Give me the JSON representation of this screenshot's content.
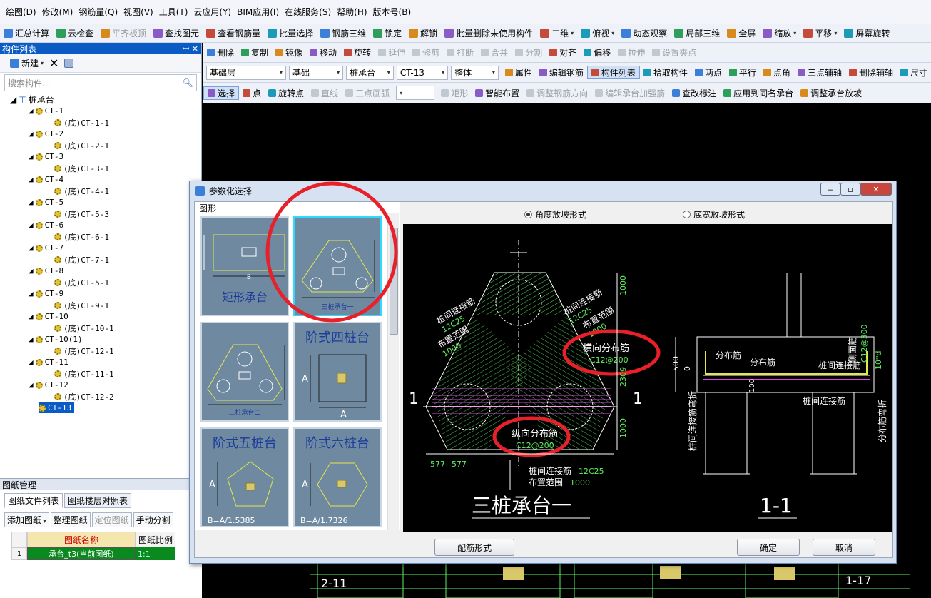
{
  "menubar": [
    "绘图(D)",
    "修改(M)",
    "钢筋量(Q)",
    "视图(V)",
    "工具(T)",
    "云应用(Y)",
    "BIM应用(I)",
    "在线服务(S)",
    "帮助(H)",
    "版本号(B)"
  ],
  "toolbar1": [
    {
      "label": "汇总计算",
      "icon": "sigma-icon"
    },
    {
      "label": "云检查",
      "icon": "check-icon"
    },
    {
      "label": "平齐板顶",
      "icon": "align-icon",
      "disabled": true
    },
    {
      "label": "查找图元",
      "icon": "binoculars-icon"
    },
    {
      "label": "查看钢筋量",
      "icon": "rebar-icon"
    },
    {
      "label": "批量选择",
      "icon": "batch-icon"
    },
    {
      "label": "钢筋三维",
      "icon": "rebar3d-icon"
    },
    {
      "label": "锁定",
      "icon": "lock-icon"
    },
    {
      "label": "解锁",
      "icon": "unlock-icon"
    },
    {
      "label": "批量删除未使用构件",
      "icon": "delete-icon"
    },
    {
      "label": "二维",
      "icon": "view2d-icon",
      "dropdown": true
    },
    {
      "label": "俯视",
      "icon": "cube-icon",
      "dropdown": true
    },
    {
      "label": "动态观察",
      "icon": "orbit-icon"
    },
    {
      "label": "局部三维",
      "icon": "local3d-icon"
    },
    {
      "label": "全屏",
      "icon": "fullscreen-icon"
    },
    {
      "label": "缩放",
      "icon": "zoom-icon",
      "dropdown": true
    },
    {
      "label": "平移",
      "icon": "pan-icon",
      "dropdown": true
    },
    {
      "label": "屏幕旋转",
      "icon": "rotate-icon"
    }
  ],
  "left_pane": {
    "title": "构件列表",
    "new_label": "新建",
    "search_placeholder": "搜索构件...",
    "root": "桩承台",
    "items": [
      {
        "name": "CT-1",
        "child": "(底)CT-1-1"
      },
      {
        "name": "CT-2",
        "child": "(底)CT-2-1"
      },
      {
        "name": "CT-3",
        "child": "(底)CT-3-1"
      },
      {
        "name": "CT-4",
        "child": "(底)CT-4-1"
      },
      {
        "name": "CT-5",
        "child": "(底)CT-5-3"
      },
      {
        "name": "CT-6",
        "child": "(底)CT-6-1"
      },
      {
        "name": "CT-7",
        "child": "(底)CT-7-1"
      },
      {
        "name": "CT-8",
        "child": "(底)CT-5-1"
      },
      {
        "name": "CT-9",
        "child": "(底)CT-9-1"
      },
      {
        "name": "CT-10",
        "child": "(底)CT-10-1"
      },
      {
        "name": "CT-10(1)",
        "child": "(底)CT-12-1"
      },
      {
        "name": "CT-11",
        "child": "(底)CT-11-1"
      },
      {
        "name": "CT-12",
        "child": "(底)CT-12-2"
      }
    ],
    "selected": "CT-13"
  },
  "edit_toolbar": [
    {
      "label": "删除"
    },
    {
      "label": "复制"
    },
    {
      "label": "镜像"
    },
    {
      "label": "移动"
    },
    {
      "label": "旋转"
    },
    {
      "label": "延伸",
      "disabled": true
    },
    {
      "label": "修剪",
      "disabled": true
    },
    {
      "label": "打断",
      "disabled": true
    },
    {
      "label": "合并",
      "disabled": true
    },
    {
      "label": "分割",
      "disabled": true
    },
    {
      "label": "对齐"
    },
    {
      "label": "偏移"
    },
    {
      "label": "拉伸",
      "disabled": true
    },
    {
      "label": "设置夹点",
      "disabled": true
    }
  ],
  "selector_bar": {
    "floor": "基础层",
    "category": "基础",
    "type": "桩承台",
    "element": "CT-13",
    "mode": "整体",
    "buttons": [
      "属性",
      "编辑钢筋",
      "构件列表",
      "拾取构件",
      "两点",
      "平行",
      "点角",
      "三点辅轴",
      "删除辅轴",
      "尺寸"
    ]
  },
  "draw_toolbar": [
    "选择",
    "点",
    "旋转点",
    "直线",
    "三点画弧",
    "矩形",
    "智能布置",
    "调整钢筋方向",
    "编辑承台加强筋",
    "查改标注",
    "应用到同名承台",
    "调整承台放坡"
  ],
  "dialog": {
    "title": "参数化选择",
    "gallery_label": "图形",
    "tiles": [
      {
        "caption": "矩形承台"
      },
      {
        "caption": "三桩承台一"
      },
      {
        "caption": "三桩承台二"
      },
      {
        "caption": "阶式四桩台"
      },
      {
        "caption": "阶式五桩台"
      },
      {
        "caption": "阶式六桩台"
      }
    ],
    "tile_labels": {
      "B": "B",
      "A": "A",
      "five_formula": "B=A/1.5385",
      "six_formula": "B=A/1.7326"
    },
    "radio_angle": "角度放坡形式",
    "radio_width": "底宽放坡形式",
    "rebar_form_button": "配筋形式",
    "ok_button": "确定",
    "cancel_button": "取消",
    "preview": {
      "title": "三桩承台一",
      "section_title": "1-1",
      "section_mark": "1",
      "labels": {
        "pile_conn_left": "桩间连接筋",
        "pile_conn_left_val": "12C25",
        "range_left": "布置范围",
        "range_left_val": "1000",
        "pile_conn_right": "桩间连接筋",
        "pile_conn_right_val": "12C25",
        "range_right": "布置范围",
        "range_right_val": "1000",
        "transverse": "横向分布筋",
        "transverse_val": "C12@200",
        "longitudinal": "纵向分布筋",
        "longitudinal_val": "C12@200",
        "pile_conn_bottom": "桩间连接筋",
        "pile_conn_bottom_val": "12C25",
        "range_bottom": "布置范围",
        "range_bottom_val": "1000",
        "dim_577a": "577",
        "dim_577b": "577",
        "dim_1000a": "1000",
        "dim_2309": "2309",
        "dim_1000b": "1000",
        "sec_dist1": "分布筋",
        "sec_dist2": "分布筋",
        "sec_conn": "桩间连接筋",
        "sec_conn2": "桩间连接筋",
        "sec_500": "500",
        "sec_0": "0",
        "sec_100": "100",
        "sec_hook_left": "桩间连接筋弯折",
        "sec_hook_right": "分布筋弯折",
        "sec_side": "侧面筋",
        "sec_side_val": "C12@300",
        "sec_10d": "10*d"
      }
    }
  },
  "drawing_manager": {
    "title": "图纸管理",
    "tab1": "图纸文件列表",
    "tab2": "图纸楼层对照表",
    "buttons": [
      {
        "label": "添加图纸",
        "dropdown": true
      },
      {
        "label": "整理图纸"
      },
      {
        "label": "定位图纸",
        "disabled": true
      },
      {
        "label": "手动分割"
      }
    ],
    "col_name": "图纸名称",
    "col_scale": "图纸比例",
    "rows": [
      {
        "index": "1",
        "name": "承台_t3(当前图纸)",
        "scale": "1:1"
      }
    ]
  },
  "canvas_labels": {
    "left": "2-11",
    "right": "1-17"
  },
  "colors": {
    "accent": "#0a5bc4",
    "cad_green": "#5ef05e",
    "cad_magenta": "#e040e0",
    "annotation_red": "#e8202a",
    "tile_bg": "#6f8aa0",
    "tile_selected": "#2fd9ff"
  }
}
